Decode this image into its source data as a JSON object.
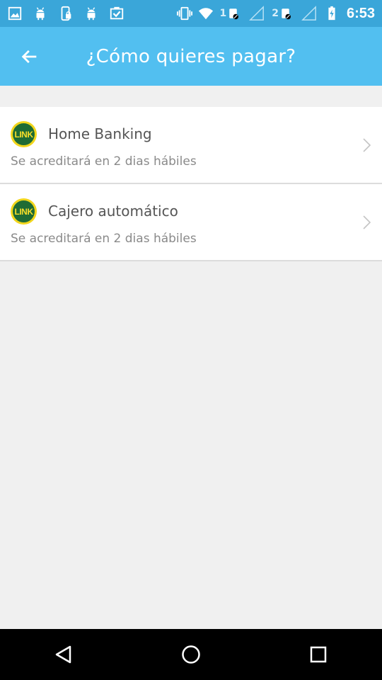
{
  "status_bar": {
    "sim1_label": "1",
    "sim2_label": "2",
    "time": "6:53",
    "icons": [
      "image-icon",
      "android-icon",
      "phone-lock-icon",
      "android-icon",
      "clipboard-check-icon",
      "vibrate-icon",
      "wifi-icon",
      "sim1-signal-icon",
      "sim2-signal-icon",
      "battery-charging-icon"
    ]
  },
  "toolbar": {
    "title": "¿Cómo quieres pagar?",
    "back_icon": "arrow-left-icon"
  },
  "options": [
    {
      "title": "Home Banking",
      "subtitle": "Se acreditará en 2 dias hábiles",
      "logo_text": "LINK"
    },
    {
      "title": "Cajero automático",
      "subtitle": "Se acreditará en 2 dias hábiles",
      "logo_text": "LINK"
    }
  ],
  "colors": {
    "statusbar": "#3aa6d9",
    "toolbar": "#52bff0",
    "background": "#f0f0f0",
    "link_yellow": "#f2d61c",
    "link_green": "#1f6b34"
  },
  "nav_bar": {
    "icons": [
      "back-triangle-icon",
      "home-circle-icon",
      "recents-square-icon"
    ]
  }
}
